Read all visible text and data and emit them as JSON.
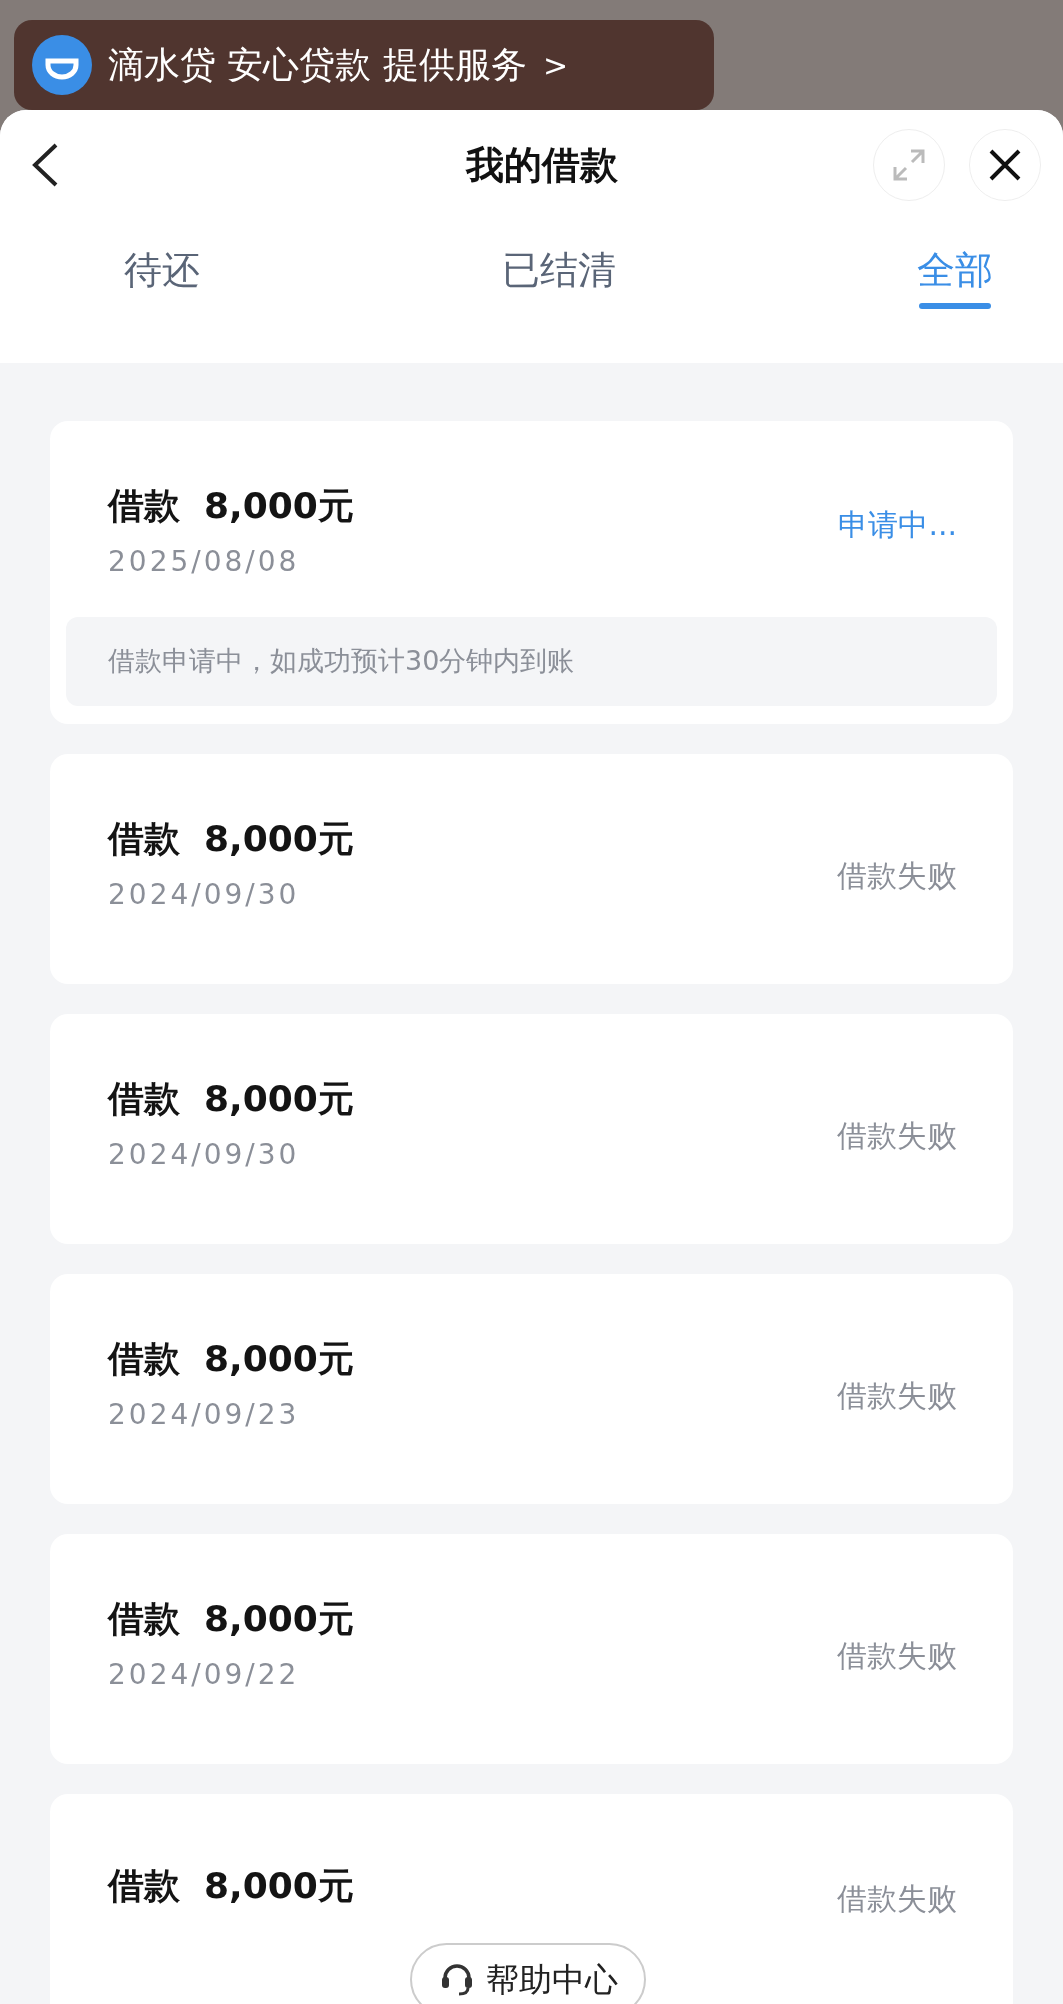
{
  "banner": {
    "text": "滴水贷 安心贷款 提供服务",
    "arrow": ">"
  },
  "header": {
    "title": "我的借款"
  },
  "tabs": [
    {
      "label": "待还",
      "selected": false
    },
    {
      "label": "已结清",
      "selected": false
    },
    {
      "label": "全部",
      "selected": true
    }
  ],
  "loans": [
    {
      "kind": "pending",
      "label": "借款",
      "amount": "8,000元",
      "date": "2025/08/08",
      "status": "申请中...",
      "note": "借款申请中，如成功预计30分钟内到账"
    },
    {
      "kind": "failed",
      "label": "借款",
      "amount": "8,000元",
      "date": "2024/09/30",
      "status": "借款失败"
    },
    {
      "kind": "failed",
      "label": "借款",
      "amount": "8,000元",
      "date": "2024/09/30",
      "status": "借款失败"
    },
    {
      "kind": "failed",
      "label": "借款",
      "amount": "8,000元",
      "date": "2024/09/23",
      "status": "借款失败"
    },
    {
      "kind": "failed",
      "label": "借款",
      "amount": "8,000元",
      "date": "2024/09/22",
      "status": "借款失败"
    },
    {
      "kind": "failed",
      "label": "借款",
      "amount": "8,000元",
      "status": "借款失败"
    }
  ],
  "help_button": {
    "label": "帮助中心"
  }
}
